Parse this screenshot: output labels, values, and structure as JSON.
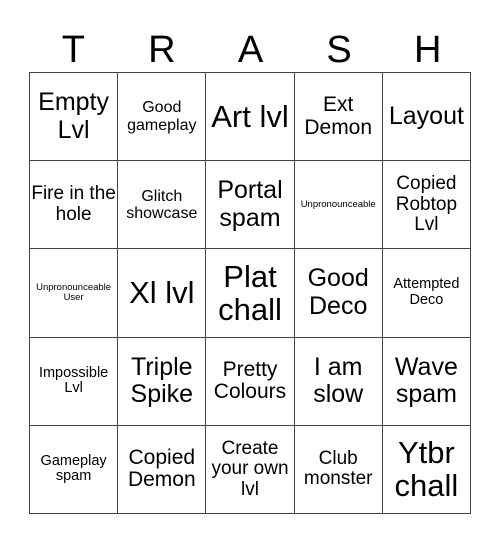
{
  "header": {
    "letters": [
      "T",
      "R",
      "A",
      "S",
      "H"
    ]
  },
  "cells": [
    {
      "text": "Empty Lvl",
      "size": "l"
    },
    {
      "text": "Good gameplay",
      "size": "s"
    },
    {
      "text": "Art lvl",
      "size": "xl"
    },
    {
      "text": "Ext Demon",
      "size": "m"
    },
    {
      "text": "Layout",
      "size": "l"
    },
    {
      "text": "Fire in the hole",
      "size": "ms"
    },
    {
      "text": "Glitch showcase",
      "size": "s"
    },
    {
      "text": "Portal spam",
      "size": "l"
    },
    {
      "text": "Unpronounceable",
      "size": "xxs"
    },
    {
      "text": "Copied Robtop Lvl",
      "size": "ms"
    },
    {
      "text": "Unpronounceable User",
      "size": "xxs"
    },
    {
      "text": "Xl lvl",
      "size": "xl"
    },
    {
      "text": "Plat chall",
      "size": "xl"
    },
    {
      "text": "Good Deco",
      "size": "l"
    },
    {
      "text": "Attempted Deco",
      "size": "xs"
    },
    {
      "text": "Impossible Lvl",
      "size": "xs"
    },
    {
      "text": "Triple Spike",
      "size": "l"
    },
    {
      "text": "Pretty Colours",
      "size": "m"
    },
    {
      "text": "I am slow",
      "size": "l"
    },
    {
      "text": "Wave spam",
      "size": "l"
    },
    {
      "text": "Gameplay spam",
      "size": "xs"
    },
    {
      "text": "Copied Demon",
      "size": "m"
    },
    {
      "text": "Create your own lvl",
      "size": "ms"
    },
    {
      "text": "Club monster",
      "size": "ms"
    },
    {
      "text": "Ytbr chall",
      "size": "xl"
    }
  ]
}
